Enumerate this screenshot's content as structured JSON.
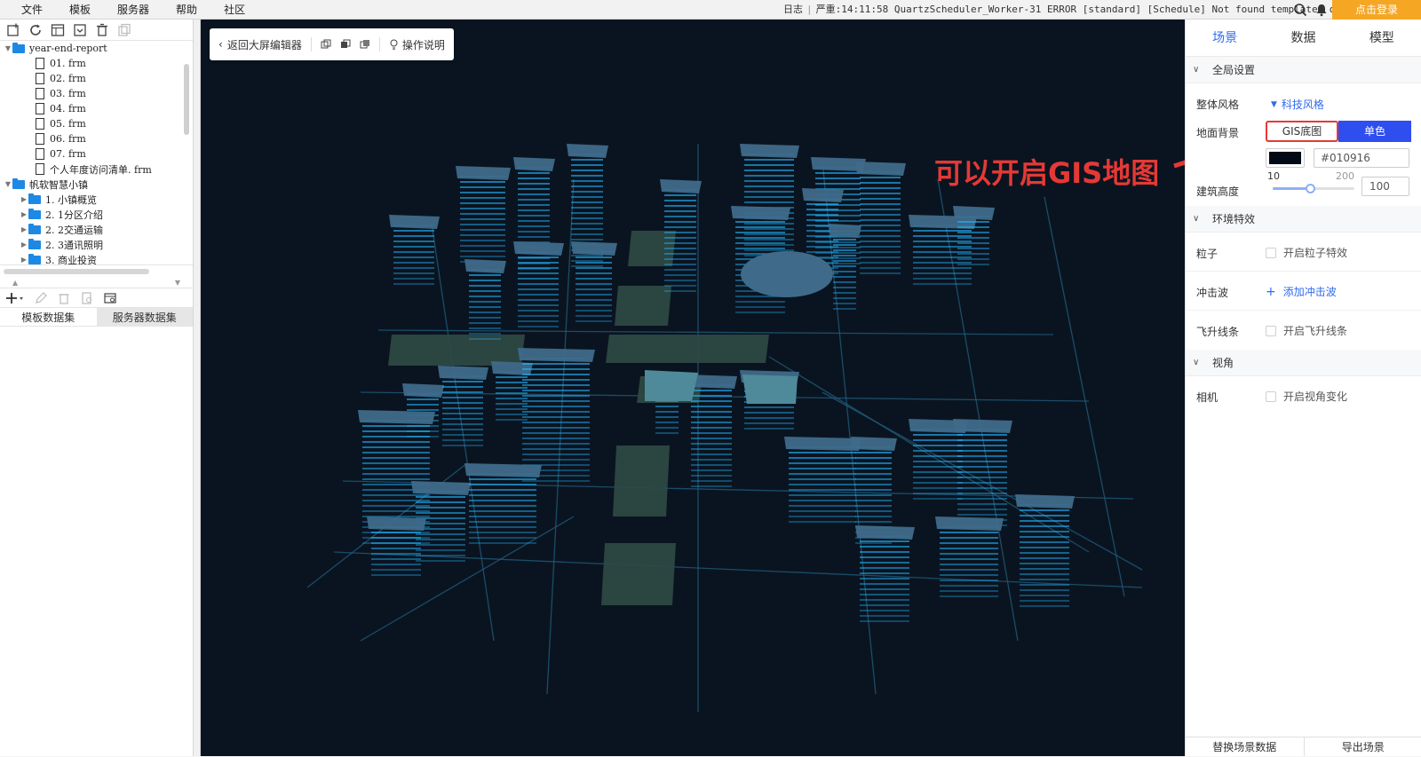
{
  "menubar": {
    "items": [
      "文件",
      "模板",
      "服务器",
      "帮助",
      "社区"
    ],
    "log_label": "日志",
    "log_text": "严重:14:11:58 QuartzScheduler_Worker-31 ERROR [standard] [Schedule] Not found template: do...",
    "login": "点击登录"
  },
  "tree": {
    "folder1": "year-end-report",
    "files": [
      "01. frm",
      "02. frm",
      "03. frm",
      "04. frm",
      "05. frm",
      "06. frm",
      "07. frm",
      "个人年度访问清单. frm"
    ],
    "folder2": "帆软智慧小镇",
    "subfolders": [
      "1. 小镇概览",
      "2. 1分区介绍",
      "2. 2交通运输",
      "2. 3通讯照明",
      "3. 商业投资"
    ]
  },
  "datasets": {
    "tab_template": "模板数据集",
    "tab_server": "服务器数据集"
  },
  "editor": {
    "back": "返回大屏编辑器",
    "help": "操作说明",
    "annotation": "可以开启GIS地图"
  },
  "panel": {
    "tabs": [
      "场景",
      "数据",
      "模型"
    ],
    "global_section": "全局设置",
    "style_label": "整体风格",
    "style_value": "科技风格",
    "ground_label": "地面背景",
    "gis_btn": "GIS底图",
    "mono_btn": "单色",
    "color_hex": "#010916",
    "height_label": "建筑高度",
    "height_min": "10",
    "height_max": "200",
    "height_value": "100",
    "height_fraction": 0.47,
    "env_section": "环境特效",
    "particle_label": "粒子",
    "particle_cb": "开启粒子特效",
    "shock_label": "冲击波",
    "shock_add": "添加冲击波",
    "flyline_label": "飞升线条",
    "flyline_cb": "开启飞升线条",
    "view_section": "视角",
    "camera_label": "相机",
    "camera_cb": "开启视角变化",
    "replace_btn": "替换场景数据",
    "export_btn": "导出场景"
  },
  "colors": {
    "canvas_bg": "#0a1420",
    "accent": "#2f6bf0",
    "annotation": "#e53935",
    "login": "#f5a623"
  }
}
